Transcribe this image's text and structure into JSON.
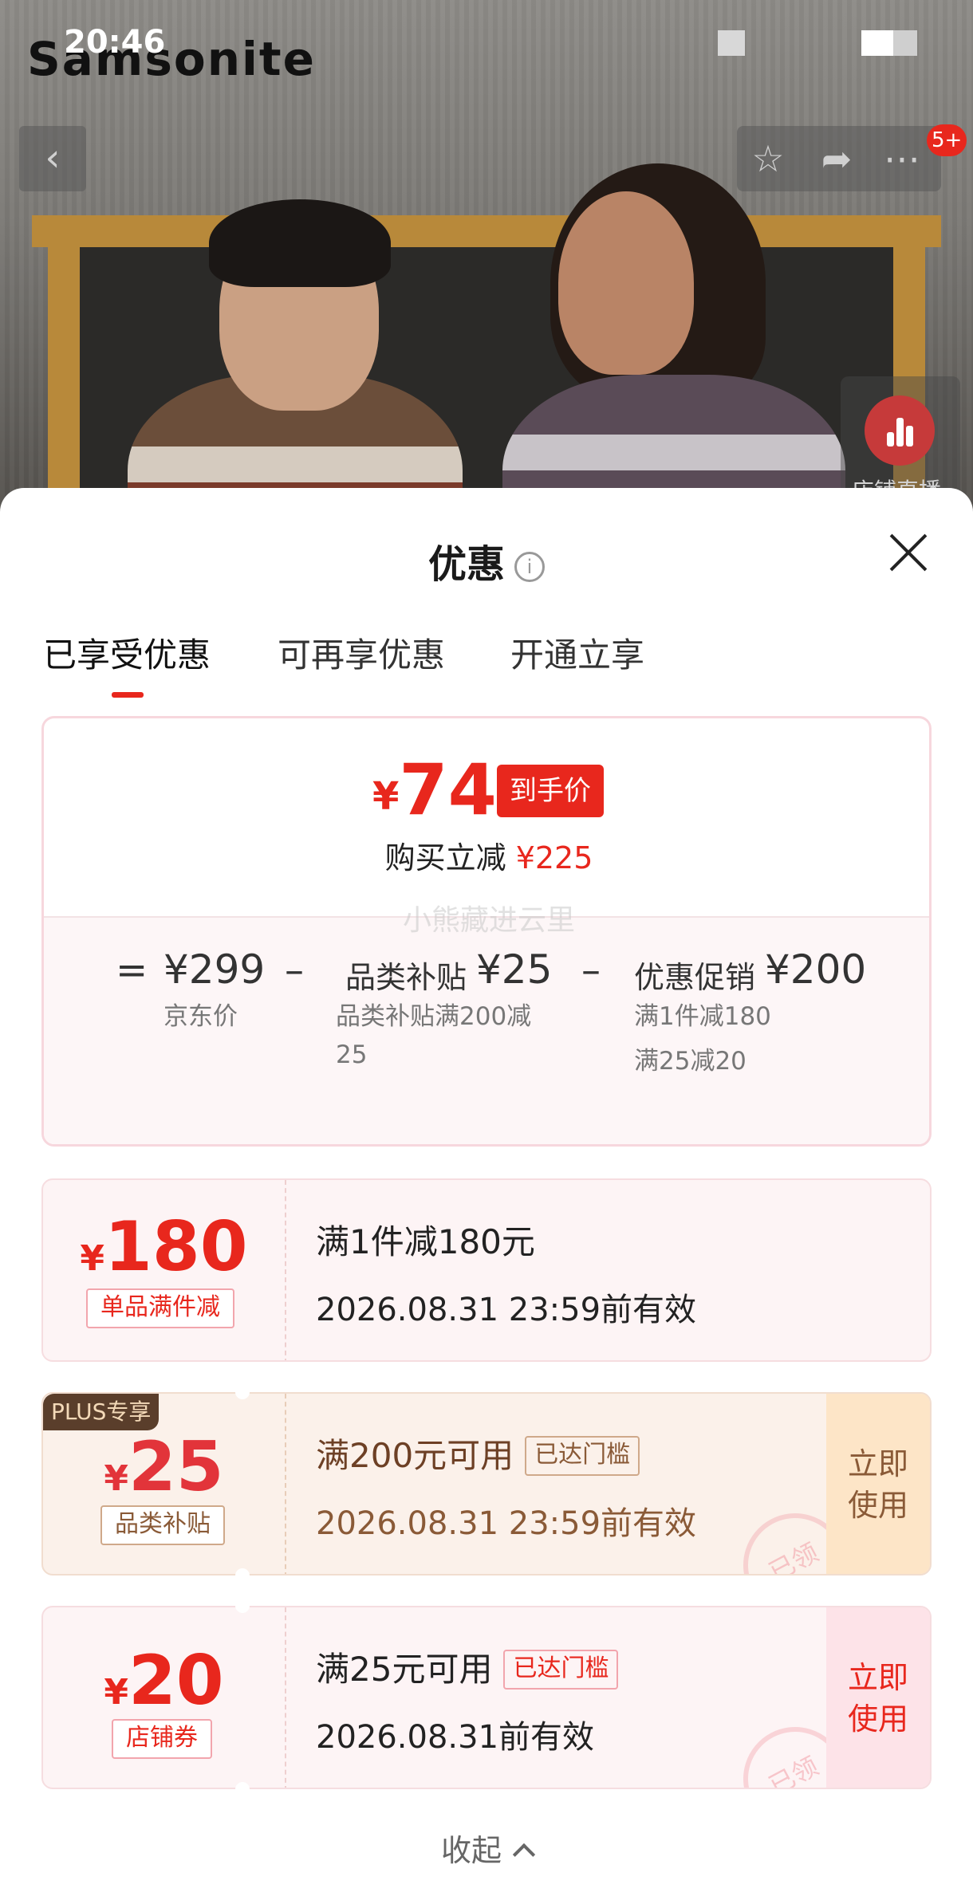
{
  "status_bar": {
    "time": "20:46"
  },
  "brand": {
    "logo_text": "Samsonite"
  },
  "header": {
    "back_icon": "chevron-left-icon",
    "action_icons": [
      "star-icon",
      "share-icon",
      "more-icon"
    ],
    "badge": "5+"
  },
  "live": {
    "label": "店铺直播",
    "icon": "live-bars-icon"
  },
  "sheet": {
    "title": "优惠",
    "info_icon": "info-icon",
    "close_icon": "close-icon",
    "tabs": [
      {
        "label": "已享受优惠",
        "active": true
      },
      {
        "label": "可再享优惠",
        "active": false
      },
      {
        "label": "开通立享",
        "active": false
      }
    ],
    "summary": {
      "currency": "¥",
      "final_price": "74",
      "final_tag": "到手价",
      "save_label": "购买立减",
      "save_amount": "¥225",
      "watermark": "小熊藏进云里",
      "eq_sign": "=",
      "minus_sign": "–",
      "jd_price": "¥299",
      "jd_label": "京东价",
      "subsidy_label": "品类补贴",
      "subsidy_value": "¥25",
      "subsidy_desc_1": "品类补贴满200减",
      "subsidy_desc_2": "25",
      "promo_label": "优惠促销",
      "promo_value": "¥200",
      "promo_desc_1": "满1件减180",
      "promo_desc_2": "满25减20"
    },
    "coupons": [
      {
        "currency": "¥",
        "amount": "180",
        "type": "单品满件减",
        "title": "满1件减180元",
        "expiry": "2026.08.31 23:59前有效"
      },
      {
        "plus_tag": "PLUS专享",
        "currency": "¥",
        "amount": "25",
        "type": "品类补贴",
        "title": "满200元可用",
        "threshold": "已达门槛",
        "expiry": "2026.08.31 23:59前有效",
        "action_1": "立即",
        "action_2": "使用",
        "stamp": "已领"
      },
      {
        "currency": "¥",
        "amount": "20",
        "type": "店铺券",
        "title": "满25元可用",
        "threshold": "已达门槛",
        "expiry": "2026.08.31前有效",
        "action_1": "立即",
        "action_2": "使用",
        "stamp": "已领"
      }
    ],
    "collapse_label": "收起"
  },
  "colors": {
    "accent_red": "#e8271d",
    "plus_brown": "#5a3e2b",
    "plus_bg": "#fde5c7"
  }
}
